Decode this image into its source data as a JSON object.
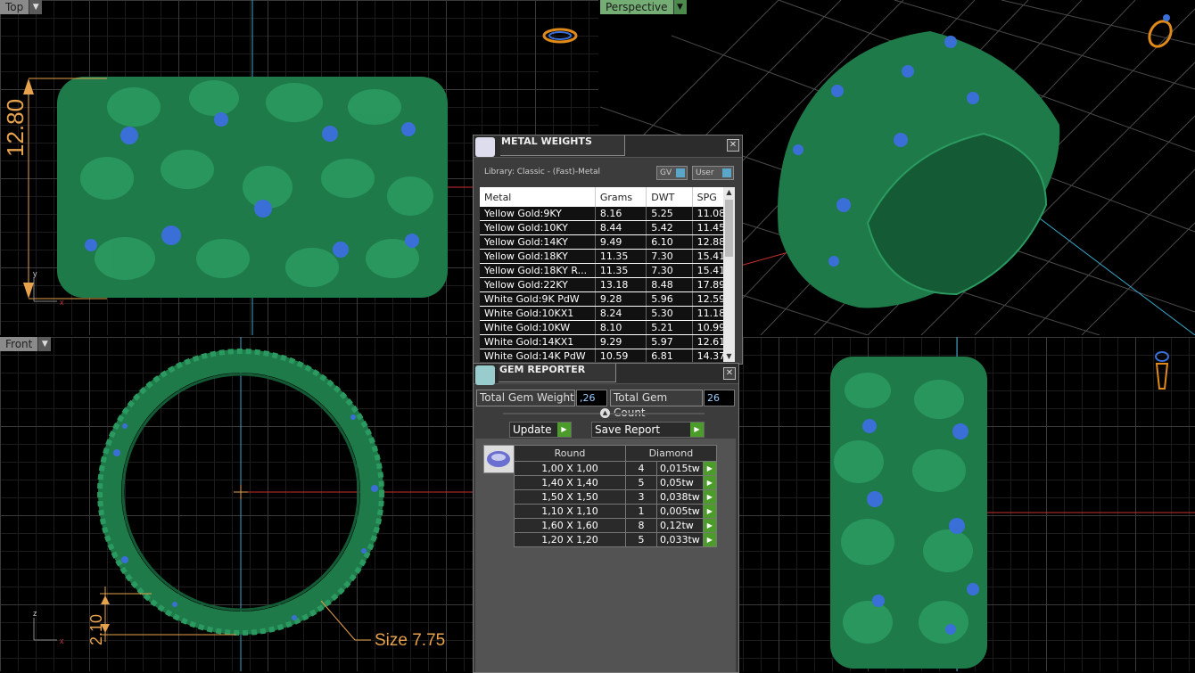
{
  "viewports": {
    "top": {
      "label": "Top"
    },
    "perspective": {
      "label": "Perspective"
    },
    "front": {
      "label": "Front"
    }
  },
  "annotations": {
    "height_dim": "12.80",
    "thickness_dim": "2.10",
    "size_label": "Size 7.75"
  },
  "metal_weights": {
    "title": "METAL WEIGHTS",
    "library": "Library: Classic - (Fast)-Metal",
    "gv_label": "GV",
    "user_label": "User",
    "columns": [
      "Metal",
      "Grams",
      "DWT",
      "SPG"
    ],
    "rows": [
      [
        "Yellow Gold:9KY",
        "8.16",
        "5.25",
        "11.08"
      ],
      [
        "Yellow Gold:10KY",
        "8.44",
        "5.42",
        "11.45"
      ],
      [
        "Yellow Gold:14KY",
        "9.49",
        "6.10",
        "12.88"
      ],
      [
        "Yellow Gold:18KY",
        "11.35",
        "7.30",
        "15.41"
      ],
      [
        "Yellow Gold:18KY R...",
        "11.35",
        "7.30",
        "15.41"
      ],
      [
        "Yellow Gold:22KY",
        "13.18",
        "8.48",
        "17.89"
      ],
      [
        "White Gold:9K PdW",
        "9.28",
        "5.96",
        "12.59"
      ],
      [
        "White Gold:10KX1",
        "8.24",
        "5.30",
        "11.18"
      ],
      [
        "White Gold:10KW",
        "8.10",
        "5.21",
        "10.99"
      ],
      [
        "White Gold:14KX1",
        "9.29",
        "5.97",
        "12.61"
      ],
      [
        "White Gold:14K PdW",
        "10.59",
        "6.81",
        "14.37"
      ]
    ]
  },
  "gem_reporter": {
    "title": "GEM REPORTER",
    "total_weight_label": "Total Gem Weight",
    "total_weight_value": ",26",
    "total_count_label": "Total Gem Count",
    "total_count_value": "26",
    "update_label": "Update",
    "save_label": "Save Report",
    "shape_header": "Round",
    "stone_header": "Diamond",
    "rows": [
      [
        "1,00 X 1,00",
        "4",
        "0,015tw"
      ],
      [
        "1,40 X 1,40",
        "5",
        "0,05tw"
      ],
      [
        "1,50 X 1,50",
        "3",
        "0,038tw"
      ],
      [
        "1,10 X 1,10",
        "1",
        "0,005tw"
      ],
      [
        "1,60 X 1,60",
        "8",
        "0,12tw"
      ],
      [
        "1,20 X 1,20",
        "5",
        "0,033tw"
      ]
    ]
  },
  "colors": {
    "metal": "#1f7a4a",
    "gem": "#3b6fd8",
    "dimension": "#e6a24d",
    "accent_green": "#4c9c2c"
  }
}
